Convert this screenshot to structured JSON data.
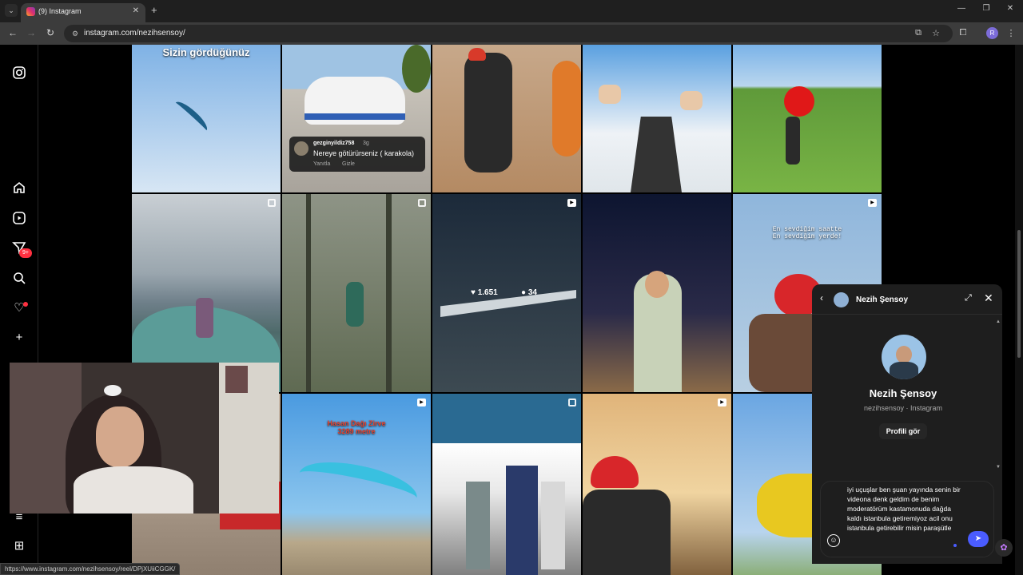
{
  "browser": {
    "tab_title": "(9) Instagram",
    "url": "instagram.com/nezihsensoy/",
    "profile_initial": "R",
    "status_url": "https://www.instagram.com/nezihsensoy/reel/DPjXUiiCGGK/"
  },
  "grid": {
    "caption_first": "Sizin gördüğünüz",
    "comment": {
      "username": "gezginyildiz758",
      "time": "3g",
      "text": "Nereye götürürseniz ( karakola)",
      "reply": "Yanıtla",
      "hide": "Gizle"
    },
    "hover": {
      "likes": "1.651",
      "comments": "34"
    },
    "caption_sunset": "En sevdiğim saatte\nEn sevdiğim yerde!",
    "caption_hasan": "Hasan Dağı Zirve\n3289 metre"
  },
  "sidebar": {
    "notif_count": "9+"
  },
  "chat": {
    "header_name": "Nezih Şensoy",
    "profile_name": "Nezih Şensoy",
    "profile_sub": "nezihsensoy · Instagram",
    "profile_btn": "Profili gör",
    "draft": "iyi uçuşlar ben şuan yayında senin bir videona denk geldim de benim moderatörüm kastamonuda dağda kaldı istanbula getiremiyoz acil onu istanbula getirebilir misin paraşütle"
  },
  "colors": {
    "accent": "#4a5cff",
    "badge": "#ff3040"
  }
}
